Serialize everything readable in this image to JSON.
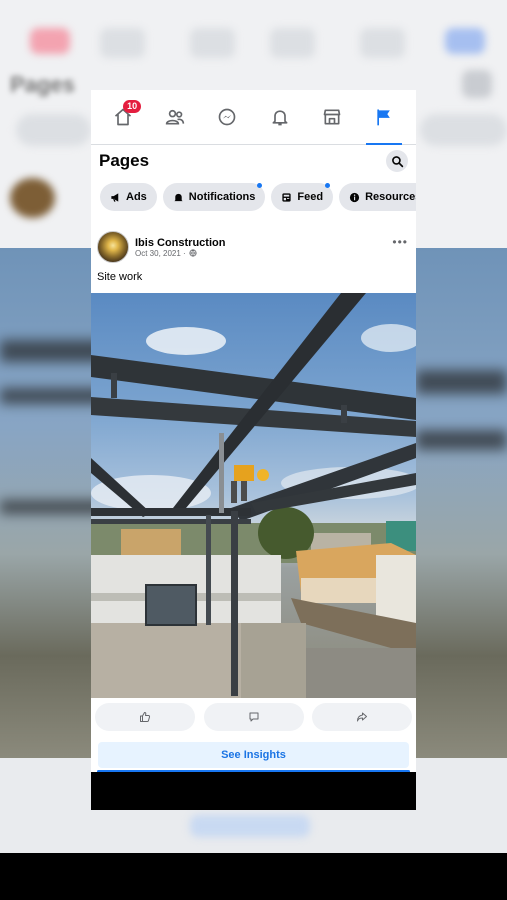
{
  "nav": {
    "home_badge": "10",
    "items": [
      "home-icon",
      "friends-icon",
      "messenger-icon",
      "bell-icon",
      "marketplace-icon",
      "flag-icon"
    ]
  },
  "pages": {
    "title": "Pages"
  },
  "chips": [
    {
      "label": "Ads",
      "icon": "megaphone-icon",
      "dot": false
    },
    {
      "label": "Notifications",
      "icon": "bell-icon",
      "dot": true
    },
    {
      "label": "Feed",
      "icon": "feed-icon",
      "dot": true
    },
    {
      "label": "Resources",
      "icon": "info-icon",
      "dot": false
    }
  ],
  "post": {
    "author": "Ibis Construction",
    "date": "Oct 30, 2021 ·",
    "text": "Site work"
  },
  "insights": {
    "label": "See Insights"
  },
  "colors": {
    "accent": "#1877f2",
    "badge": "#e41e3f",
    "chip_bg": "#e4e6eb",
    "insights_bg": "#e7f3ff"
  }
}
